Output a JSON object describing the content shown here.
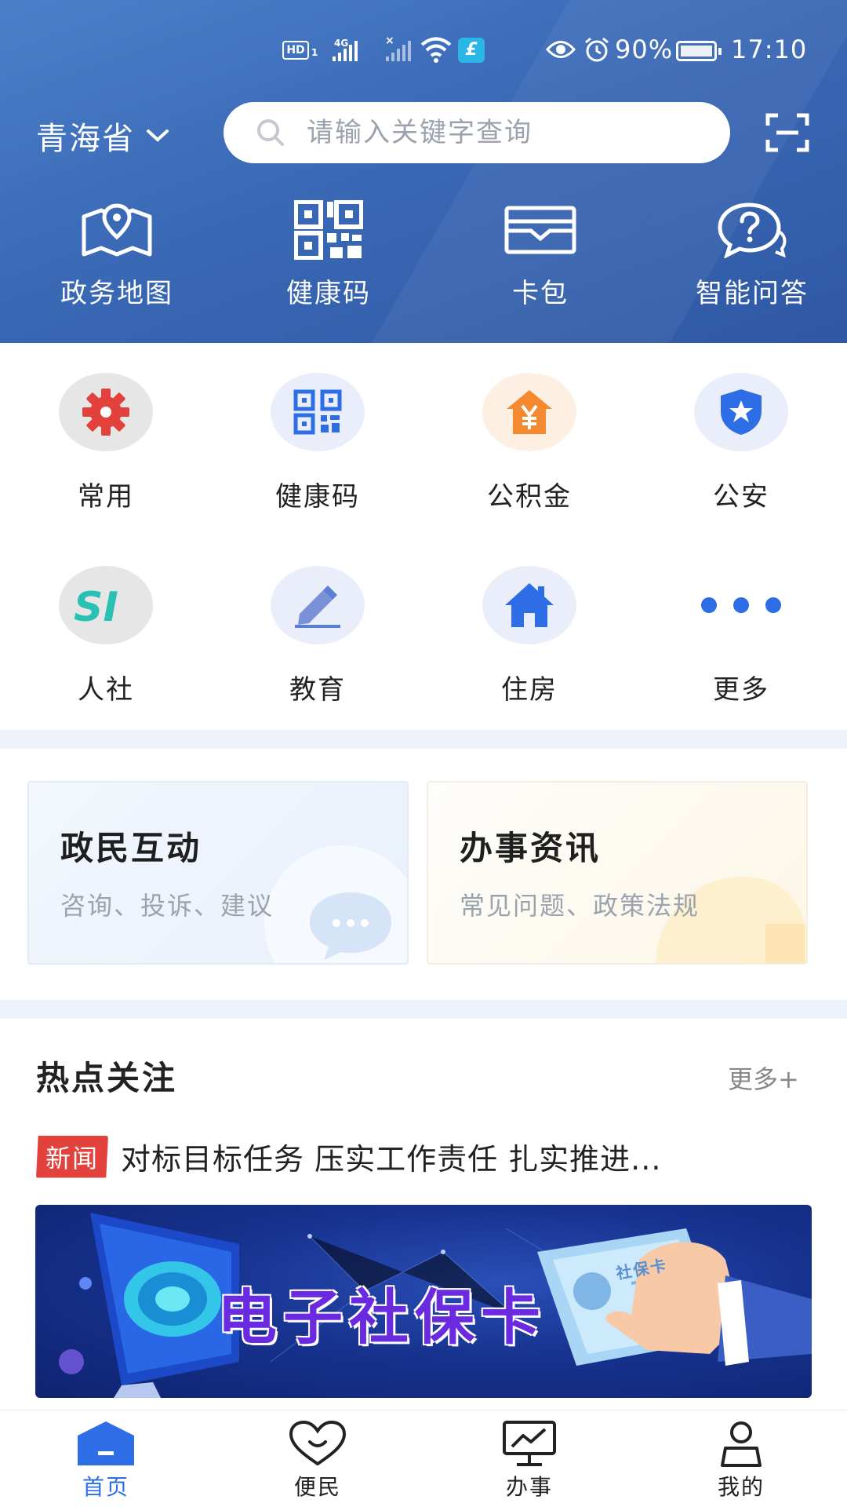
{
  "status_bar": {
    "hd": "HD",
    "sim": "1",
    "network": "4G",
    "battery": "90%",
    "time": "17:10"
  },
  "header": {
    "region": "青海省",
    "search_placeholder": "请输入关键字查询",
    "quick": [
      {
        "label": "政务地图",
        "icon": "map-pin-icon"
      },
      {
        "label": "健康码",
        "icon": "qr-code-icon"
      },
      {
        "label": "卡包",
        "icon": "card-wallet-icon"
      },
      {
        "label": "智能问答",
        "icon": "question-bubble-icon"
      }
    ]
  },
  "services": [
    {
      "label": "常用",
      "icon": "gear-icon",
      "color": "#e2413c"
    },
    {
      "label": "健康码",
      "icon": "qr-code-icon",
      "color": "#2d6ee6"
    },
    {
      "label": "公积金",
      "icon": "house-fund-icon",
      "color": "#f5892f"
    },
    {
      "label": "公安",
      "icon": "police-shield-icon",
      "color": "#2d6ee6"
    },
    {
      "label": "人社",
      "icon": "si-logo-icon",
      "color": "#2ac1b4"
    },
    {
      "label": "教育",
      "icon": "pencil-icon",
      "color": "#5b7fd3"
    },
    {
      "label": "住房",
      "icon": "house-icon",
      "color": "#2d6ee6"
    },
    {
      "label": "更多",
      "icon": "more-dots-icon",
      "color": "#2d6ee6"
    }
  ],
  "cards": [
    {
      "title": "政民互动",
      "subtitle": "咨询、投诉、建议"
    },
    {
      "title": "办事资讯",
      "subtitle": "常见问题、政策法规"
    }
  ],
  "hot": {
    "title": "热点关注",
    "more": "更多+",
    "news_badge": "新闻",
    "news_text": "对标目标任务 压实工作责任 扎实推进...",
    "banner_title": "电子社保卡",
    "banner_card_text": "社保卡"
  },
  "tabs": [
    {
      "label": "首页",
      "active": true
    },
    {
      "label": "便民",
      "active": false
    },
    {
      "label": "办事",
      "active": false
    },
    {
      "label": "我的",
      "active": false
    }
  ],
  "colors": {
    "header_blue": "#3a69b6",
    "accent_blue": "#2d6ee6",
    "news_red": "#e2413c"
  }
}
